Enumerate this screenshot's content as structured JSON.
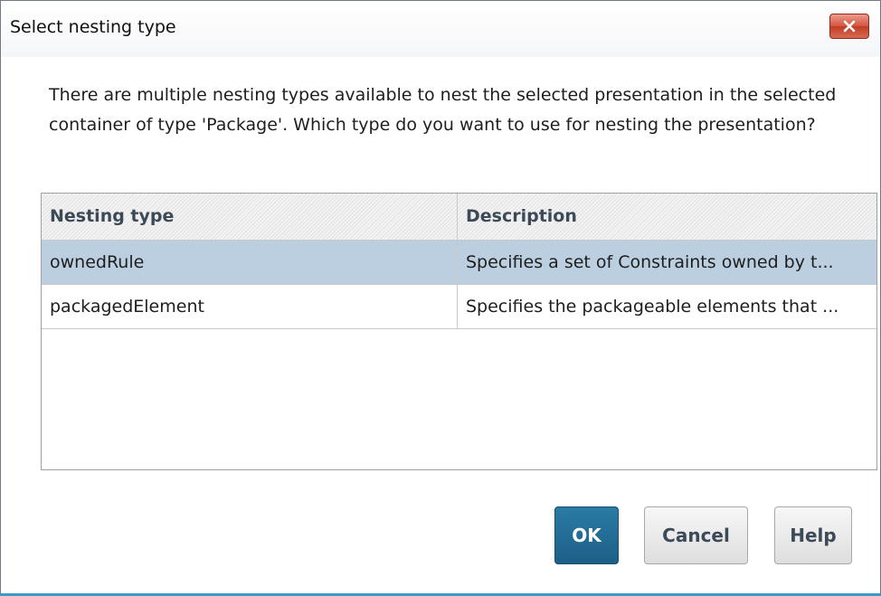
{
  "dialog": {
    "title": "Select nesting type",
    "prompt": "There are multiple nesting types available to nest the selected presentation in the selected container of type 'Package'. Which type do you want to use for nesting the presentation?"
  },
  "table": {
    "columns": [
      "Nesting type",
      "Description"
    ],
    "rows": [
      {
        "nesting_type": "ownedRule",
        "description": "Specifies a set of Constraints owned by t...",
        "selected": true
      },
      {
        "nesting_type": "packagedElement",
        "description": "Specifies the packageable elements that ...",
        "selected": false
      }
    ]
  },
  "buttons": {
    "ok": "OK",
    "cancel": "Cancel",
    "help": "Help"
  },
  "icons": {
    "close": "close-icon"
  },
  "colors": {
    "ok_button": "#1c5f86",
    "selected_row": "#bccfe0",
    "close_button": "#c23b23",
    "window_bottom_border": "#3a9bc9"
  }
}
